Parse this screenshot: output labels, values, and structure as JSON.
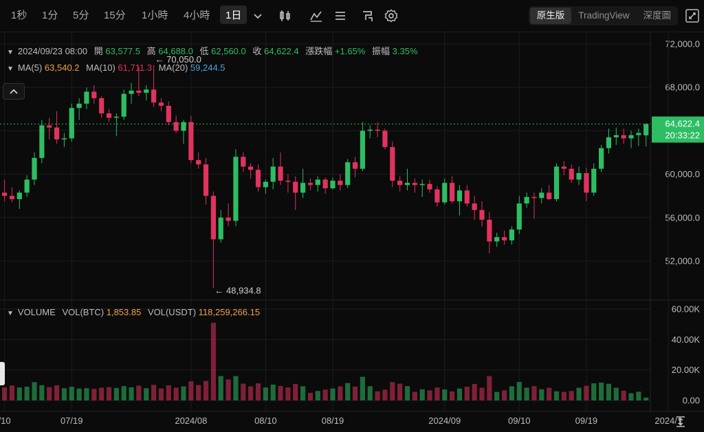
{
  "toolbar": {
    "timeframes": [
      "1秒",
      "1分",
      "5分",
      "15分",
      "1小時",
      "4小時",
      "1日"
    ],
    "active_timeframe": "1日",
    "views": [
      "原生版",
      "TradingView",
      "深度圖"
    ],
    "active_view": "原生版"
  },
  "legend": {
    "date": "2024/09/23 08:00",
    "open_label": "開",
    "open": "63,577.5",
    "high_label": "高",
    "high": "64,688.0",
    "low_label": "低",
    "low": "62,560.0",
    "close_label": "收",
    "close": "64,622.4",
    "change_label": "漲跌幅",
    "change": "+1.65%",
    "amp_label": "振幅",
    "amp": "3.35%",
    "ma5_label": "MA(5)",
    "ma5": "63,540.2",
    "ma10_label": "MA(10)",
    "ma10": "61,711.3",
    "ma20_label": "MA(20)",
    "ma20": "59,244.5",
    "vol_title": "VOLUME",
    "vol_btc_label": "VOL(BTC)",
    "vol_btc": "1,853.85",
    "vol_usdt_label": "VOL(USDT)",
    "vol_usdt": "118,259,266.15"
  },
  "colors": {
    "up": "#2ebd63",
    "down": "#e0335e",
    "ma5": "#f0a04b",
    "ma10": "#e0335e",
    "ma20": "#4aa3df",
    "grid": "#1c1c1c"
  },
  "price_tag": {
    "price": "64,622.4",
    "countdown": "20:33:22"
  },
  "annotations": {
    "high": "70,050.0",
    "low": "48,934.8"
  },
  "chart_data": {
    "type": "candlestick",
    "price_axis_ticks": [
      "72,000.0",
      "68,000.0",
      "64,000.0",
      "60,000.0",
      "56,000.0",
      "52,000.0"
    ],
    "price_axis_values": [
      72000,
      68000,
      64000,
      60000,
      56000,
      52000
    ],
    "ylim": [
      48000,
      73000
    ],
    "volume_axis_ticks": [
      "60.00K",
      "40.00K",
      "20.00K",
      "0.00"
    ],
    "volume_axis_values": [
      60000,
      40000,
      20000,
      0
    ],
    "x_axis_ticks": [
      "/10",
      "07/19",
      "2024/08",
      "08/10",
      "08/19",
      "2024/09",
      "09/10",
      "09/19",
      "2024/1"
    ],
    "x_tick_candle_index": [
      0,
      9,
      25,
      35,
      44,
      59,
      69,
      78,
      89
    ],
    "current_price": 64622.4,
    "candles": [
      {
        "o": 58300,
        "h": 59500,
        "l": 57500,
        "c": 58000,
        "v": 8500
      },
      {
        "o": 58000,
        "h": 58800,
        "l": 57400,
        "c": 57700,
        "v": 9800
      },
      {
        "o": 57700,
        "h": 58500,
        "l": 56800,
        "c": 58300,
        "v": 8500
      },
      {
        "o": 58300,
        "h": 59900,
        "l": 57900,
        "c": 59500,
        "v": 9000
      },
      {
        "o": 59500,
        "h": 62000,
        "l": 59000,
        "c": 61500,
        "v": 12000
      },
      {
        "o": 61500,
        "h": 65000,
        "l": 61000,
        "c": 64500,
        "v": 10000
      },
      {
        "o": 64500,
        "h": 65200,
        "l": 63200,
        "c": 64300,
        "v": 8700
      },
      {
        "o": 64300,
        "h": 65800,
        "l": 62800,
        "c": 63200,
        "v": 9900
      },
      {
        "o": 63200,
        "h": 63800,
        "l": 62500,
        "c": 63300,
        "v": 8000
      },
      {
        "o": 63300,
        "h": 66500,
        "l": 63000,
        "c": 66100,
        "v": 9000
      },
      {
        "o": 66100,
        "h": 67000,
        "l": 65000,
        "c": 66500,
        "v": 7800
      },
      {
        "o": 66500,
        "h": 68000,
        "l": 66000,
        "c": 67600,
        "v": 8000
      },
      {
        "o": 67600,
        "h": 68200,
        "l": 66500,
        "c": 67000,
        "v": 7600
      },
      {
        "o": 67000,
        "h": 67200,
        "l": 65200,
        "c": 65600,
        "v": 8400
      },
      {
        "o": 65600,
        "h": 66000,
        "l": 64800,
        "c": 65200,
        "v": 8700
      },
      {
        "o": 65200,
        "h": 65600,
        "l": 63500,
        "c": 65300,
        "v": 8200
      },
      {
        "o": 65300,
        "h": 67800,
        "l": 65000,
        "c": 67400,
        "v": 9400
      },
      {
        "o": 67400,
        "h": 68400,
        "l": 66500,
        "c": 67700,
        "v": 8600
      },
      {
        "o": 67700,
        "h": 69900,
        "l": 67200,
        "c": 67500,
        "v": 9700
      },
      {
        "o": 67500,
        "h": 68200,
        "l": 66800,
        "c": 67800,
        "v": 8000
      },
      {
        "o": 67800,
        "h": 70050,
        "l": 66200,
        "c": 66600,
        "v": 10200
      },
      {
        "o": 66600,
        "h": 67000,
        "l": 65800,
        "c": 66300,
        "v": 7800
      },
      {
        "o": 66300,
        "h": 66700,
        "l": 64500,
        "c": 64800,
        "v": 9900
      },
      {
        "o": 64800,
        "h": 65400,
        "l": 63800,
        "c": 64000,
        "v": 8400
      },
      {
        "o": 64000,
        "h": 65000,
        "l": 62800,
        "c": 64800,
        "v": 9200
      },
      {
        "o": 64800,
        "h": 65400,
        "l": 61000,
        "c": 61300,
        "v": 12500
      },
      {
        "o": 61300,
        "h": 62000,
        "l": 60500,
        "c": 60900,
        "v": 10100
      },
      {
        "o": 60900,
        "h": 61500,
        "l": 57200,
        "c": 58000,
        "v": 12800
      },
      {
        "o": 58000,
        "h": 58400,
        "l": 49500,
        "c": 54000,
        "v": 51000
      },
      {
        "o": 54000,
        "h": 56700,
        "l": 53700,
        "c": 56000,
        "v": 16000
      },
      {
        "o": 56000,
        "h": 57300,
        "l": 55200,
        "c": 55700,
        "v": 13800
      },
      {
        "o": 55700,
        "h": 62300,
        "l": 55200,
        "c": 61600,
        "v": 16000
      },
      {
        "o": 61600,
        "h": 62000,
        "l": 60200,
        "c": 60700,
        "v": 11000
      },
      {
        "o": 60700,
        "h": 61000,
        "l": 59600,
        "c": 60400,
        "v": 9200
      },
      {
        "o": 60400,
        "h": 60900,
        "l": 58400,
        "c": 58800,
        "v": 11200
      },
      {
        "o": 58800,
        "h": 59500,
        "l": 58200,
        "c": 59300,
        "v": 8500
      },
      {
        "o": 59300,
        "h": 61500,
        "l": 58600,
        "c": 60700,
        "v": 10400
      },
      {
        "o": 60700,
        "h": 62000,
        "l": 59000,
        "c": 59400,
        "v": 9500
      },
      {
        "o": 59400,
        "h": 60000,
        "l": 58300,
        "c": 59300,
        "v": 8500
      },
      {
        "o": 59300,
        "h": 59800,
        "l": 56700,
        "c": 58300,
        "v": 10800
      },
      {
        "o": 58300,
        "h": 60500,
        "l": 57800,
        "c": 59200,
        "v": 9300
      },
      {
        "o": 59200,
        "h": 59600,
        "l": 58500,
        "c": 59000,
        "v": 5000
      },
      {
        "o": 59000,
        "h": 59800,
        "l": 58400,
        "c": 59500,
        "v": 6200
      },
      {
        "o": 59500,
        "h": 59700,
        "l": 58200,
        "c": 58700,
        "v": 7100
      },
      {
        "o": 58700,
        "h": 59700,
        "l": 58600,
        "c": 59400,
        "v": 7800
      },
      {
        "o": 59400,
        "h": 60000,
        "l": 58500,
        "c": 59000,
        "v": 9200
      },
      {
        "o": 59000,
        "h": 61400,
        "l": 58700,
        "c": 61100,
        "v": 11400
      },
      {
        "o": 61100,
        "h": 61600,
        "l": 59700,
        "c": 60500,
        "v": 9100
      },
      {
        "o": 60500,
        "h": 64800,
        "l": 60300,
        "c": 64000,
        "v": 15500
      },
      {
        "o": 64000,
        "h": 64500,
        "l": 63300,
        "c": 64100,
        "v": 9300
      },
      {
        "o": 64100,
        "h": 64800,
        "l": 63400,
        "c": 64000,
        "v": 6000
      },
      {
        "o": 64000,
        "h": 64200,
        "l": 62300,
        "c": 62500,
        "v": 7100
      },
      {
        "o": 62500,
        "h": 63000,
        "l": 58800,
        "c": 59400,
        "v": 12000
      },
      {
        "o": 59400,
        "h": 59800,
        "l": 58400,
        "c": 59000,
        "v": 11000
      },
      {
        "o": 59000,
        "h": 60500,
        "l": 58500,
        "c": 59200,
        "v": 9400
      },
      {
        "o": 59200,
        "h": 59600,
        "l": 58300,
        "c": 59000,
        "v": 5600
      },
      {
        "o": 59000,
        "h": 59500,
        "l": 57900,
        "c": 59100,
        "v": 7300
      },
      {
        "o": 59100,
        "h": 59500,
        "l": 58300,
        "c": 58600,
        "v": 6600
      },
      {
        "o": 58600,
        "h": 58900,
        "l": 57000,
        "c": 57400,
        "v": 8500
      },
      {
        "o": 57400,
        "h": 59600,
        "l": 57200,
        "c": 59200,
        "v": 7200
      },
      {
        "o": 59200,
        "h": 59800,
        "l": 57300,
        "c": 57500,
        "v": 5900
      },
      {
        "o": 57500,
        "h": 59000,
        "l": 56200,
        "c": 58500,
        "v": 7800
      },
      {
        "o": 58500,
        "h": 59000,
        "l": 57000,
        "c": 57300,
        "v": 9000
      },
      {
        "o": 57300,
        "h": 58000,
        "l": 55800,
        "c": 56700,
        "v": 10800
      },
      {
        "o": 56700,
        "h": 57500,
        "l": 55200,
        "c": 55800,
        "v": 8300
      },
      {
        "o": 55800,
        "h": 56500,
        "l": 52700,
        "c": 53800,
        "v": 16000
      },
      {
        "o": 53800,
        "h": 54600,
        "l": 53300,
        "c": 54200,
        "v": 5600
      },
      {
        "o": 54200,
        "h": 54800,
        "l": 53500,
        "c": 53900,
        "v": 6600
      },
      {
        "o": 53900,
        "h": 55200,
        "l": 53500,
        "c": 54900,
        "v": 9300
      },
      {
        "o": 54900,
        "h": 58000,
        "l": 54500,
        "c": 57300,
        "v": 12100
      },
      {
        "o": 57300,
        "h": 58300,
        "l": 56900,
        "c": 57900,
        "v": 8400
      },
      {
        "o": 57900,
        "h": 58300,
        "l": 55900,
        "c": 57800,
        "v": 9400
      },
      {
        "o": 57800,
        "h": 58700,
        "l": 57300,
        "c": 58300,
        "v": 7300
      },
      {
        "o": 58300,
        "h": 59000,
        "l": 57600,
        "c": 57700,
        "v": 8300
      },
      {
        "o": 57700,
        "h": 61000,
        "l": 57500,
        "c": 60700,
        "v": 6000
      },
      {
        "o": 60700,
        "h": 61200,
        "l": 59900,
        "c": 60500,
        "v": 5600
      },
      {
        "o": 60500,
        "h": 60900,
        "l": 59200,
        "c": 59500,
        "v": 6200
      },
      {
        "o": 59500,
        "h": 60700,
        "l": 59000,
        "c": 60100,
        "v": 8300
      },
      {
        "o": 60100,
        "h": 60600,
        "l": 57500,
        "c": 58300,
        "v": 9600
      },
      {
        "o": 58300,
        "h": 61000,
        "l": 58000,
        "c": 60500,
        "v": 11200
      },
      {
        "o": 60500,
        "h": 62700,
        "l": 60200,
        "c": 62400,
        "v": 11700
      },
      {
        "o": 62400,
        "h": 64200,
        "l": 61900,
        "c": 63400,
        "v": 10900
      },
      {
        "o": 63400,
        "h": 64300,
        "l": 62700,
        "c": 63600,
        "v": 8300
      },
      {
        "o": 63600,
        "h": 64200,
        "l": 62800,
        "c": 63300,
        "v": 6400
      },
      {
        "o": 63300,
        "h": 64000,
        "l": 62400,
        "c": 63600,
        "v": 4700
      },
      {
        "o": 63600,
        "h": 64200,
        "l": 62600,
        "c": 63800,
        "v": 5700
      },
      {
        "o": 63577.5,
        "h": 64688,
        "l": 62560,
        "c": 64622.4,
        "v": 1853.85
      }
    ]
  }
}
